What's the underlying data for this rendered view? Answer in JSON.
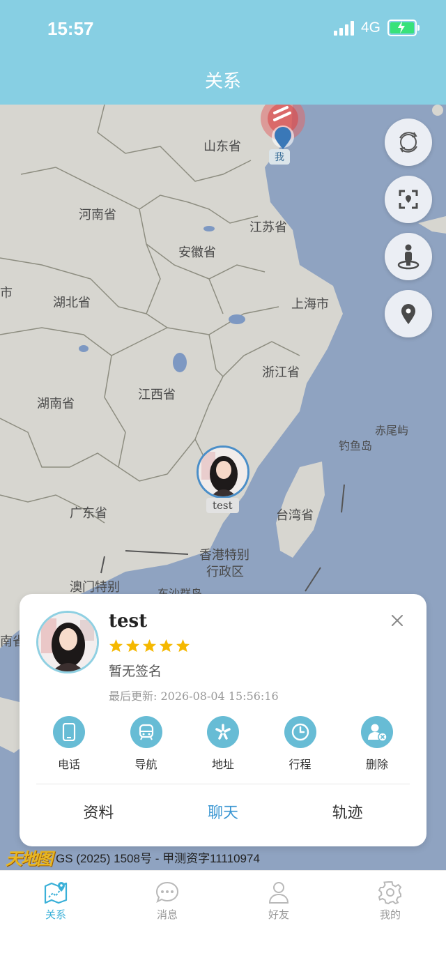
{
  "status": {
    "time": "15:57",
    "network": "4G"
  },
  "header": {
    "title": "关系"
  },
  "map": {
    "labels": {
      "shandong": "山东省",
      "henan": "河南省",
      "jiangsu": "江苏省",
      "anhui": "安徽省",
      "hubei": "湖北省",
      "shanghai": "上海市",
      "zhejiang": "浙江省",
      "jiangxi": "江西省",
      "hunan": "湖南省",
      "chiwei": "赤尾屿",
      "diaoyu": "钓鱼岛",
      "guangdong": "广东省",
      "taiwan": "台湾省",
      "hongkong_1": "香港特别",
      "hongkong_2": "行政区",
      "macau": "澳门特别",
      "dongsha": "东沙群岛",
      "edge_shi": "市",
      "edge_nan": "南省"
    },
    "me_label": "我",
    "friend_label": "test",
    "attribution_logo": "天地图",
    "attribution_text": "GS (2025) 1508号 - 甲测资字11110974"
  },
  "map_controls": [
    {
      "name": "refresh-button",
      "icon": "refresh-icon"
    },
    {
      "name": "fit-view-button",
      "icon": "fit-bounds-icon"
    },
    {
      "name": "street-view-button",
      "icon": "person-pin-icon"
    },
    {
      "name": "locate-button",
      "icon": "location-pin-icon"
    }
  ],
  "card": {
    "name": "test",
    "rating": 5,
    "signature": "暂无签名",
    "updated": "最后更新: 2026-08-04 15:56:16",
    "actions": [
      {
        "label": "电话",
        "icon": "phone-icon"
      },
      {
        "label": "导航",
        "icon": "navigation-icon"
      },
      {
        "label": "地址",
        "icon": "address-icon"
      },
      {
        "label": "行程",
        "icon": "clock-icon"
      },
      {
        "label": "删除",
        "icon": "delete-user-icon"
      }
    ],
    "links": {
      "profile": "资料",
      "chat": "聊天",
      "track": "轨迹"
    }
  },
  "tabs": [
    {
      "label": "关系",
      "icon": "map-icon",
      "active": true
    },
    {
      "label": "消息",
      "icon": "chat-bubble-icon",
      "active": false
    },
    {
      "label": "好友",
      "icon": "person-icon",
      "active": false
    },
    {
      "label": "我的",
      "icon": "gear-icon",
      "active": false
    }
  ],
  "colors": {
    "header": "#87CFE3",
    "sea": "#8FA3C1",
    "land": "#D7D6D0",
    "accent": "#3A96D2",
    "star": "#F5B800"
  }
}
